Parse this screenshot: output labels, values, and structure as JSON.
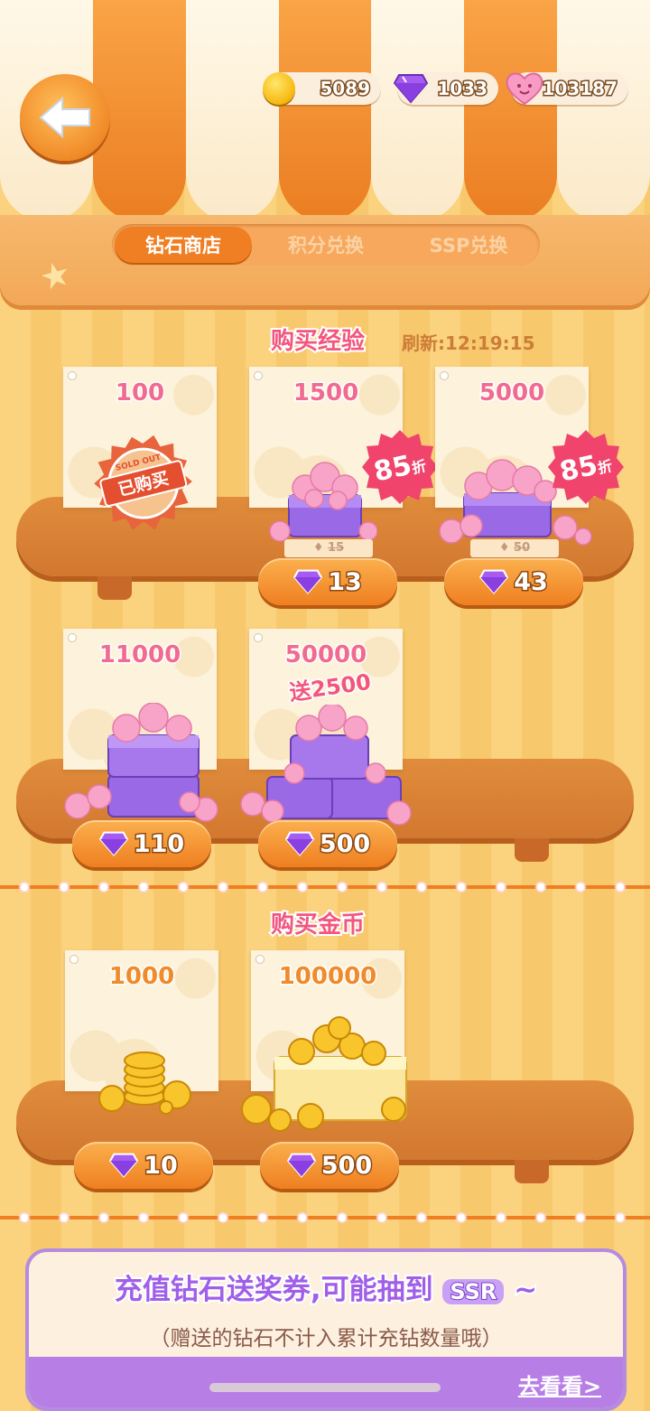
{
  "resources": {
    "coins": "5089",
    "diamonds": "1033",
    "hearts": "103187"
  },
  "tabs": [
    {
      "label": "钻石商店",
      "active": true
    },
    {
      "label": "积分兑换",
      "active": false
    },
    {
      "label": "SSP兑换",
      "active": false
    }
  ],
  "exp_section": {
    "title": "购买经验",
    "refresh": "刷新:12:19:15",
    "items": [
      {
        "amount": "100",
        "price": "",
        "sold_out": true,
        "stamp_text": "已购买",
        "stamp_ring": "SOLD OUT"
      },
      {
        "amount": "1500",
        "price": "13",
        "discount": "85",
        "discount_unit": "折",
        "original": "15"
      },
      {
        "amount": "5000",
        "price": "43",
        "discount": "85",
        "discount_unit": "折",
        "original": "50"
      },
      {
        "amount": "11000",
        "price": "110"
      },
      {
        "amount": "50000",
        "bonus": "送2500",
        "price": "500"
      }
    ]
  },
  "coin_section": {
    "title": "购买金币",
    "items": [
      {
        "amount": "1000",
        "price": "10"
      },
      {
        "amount": "100000",
        "price": "500"
      }
    ]
  },
  "promo": {
    "title": "充值钻石送奖券,可能抽到",
    "title_badge": "SSR",
    "title_tail": "~",
    "subtitle": "（赠送的钻石不计入累计充钻数量哦）",
    "link": "去看看>"
  },
  "colors": {
    "accent": "#f07e22",
    "pink": "#f2567f",
    "purple": "#a05fe8"
  }
}
